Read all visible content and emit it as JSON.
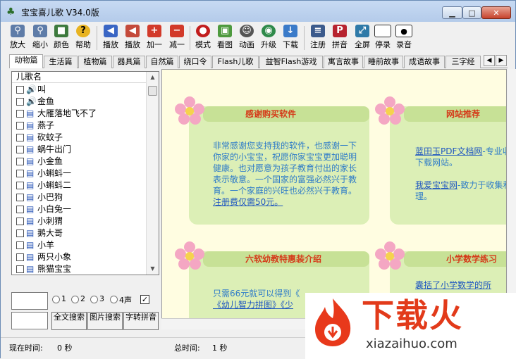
{
  "window": {
    "title": "宝宝喜儿歌 V34.0版"
  },
  "toolbar": {
    "items": [
      {
        "label": "放大",
        "icon": "zoom-in-icon"
      },
      {
        "label": "缩小",
        "icon": "zoom-out-icon"
      },
      {
        "label": "颜色",
        "icon": "color-icon"
      },
      {
        "label": "帮助",
        "icon": "help-icon"
      },
      {
        "label": "播放",
        "icon": "play-icon"
      },
      {
        "label": "播放",
        "icon": "play-all-icon"
      },
      {
        "label": "加一",
        "icon": "plus-icon"
      },
      {
        "label": "减一",
        "icon": "minus-icon"
      },
      {
        "label": "模式",
        "icon": "mode-icon"
      },
      {
        "label": "看图",
        "icon": "picture-icon"
      },
      {
        "label": "动画",
        "icon": "animation-icon"
      },
      {
        "label": "升级",
        "icon": "upgrade-icon"
      },
      {
        "label": "下载",
        "icon": "download-icon"
      },
      {
        "label": "注册",
        "icon": "register-icon"
      },
      {
        "label": "拼音",
        "icon": "pinyin-icon"
      },
      {
        "label": "全屏",
        "icon": "fullscreen-icon"
      },
      {
        "label": "停录",
        "icon": "stop-record-icon"
      },
      {
        "label": "录音",
        "icon": "record-icon"
      }
    ]
  },
  "tabs": [
    "动物篇",
    "生活篇",
    "植物篇",
    "器具篇",
    "自然篇",
    "绕口令",
    "Flash儿歌",
    "益智Flash游戏",
    "寓言故事",
    "睡前故事",
    "成语故事",
    "三字经"
  ],
  "list": {
    "header": "儿歌名",
    "items": [
      {
        "label": "叫",
        "type": "audio"
      },
      {
        "label": "金鱼",
        "type": "audio"
      },
      {
        "label": "大雁落地飞不了",
        "type": "text"
      },
      {
        "label": "燕子",
        "type": "text"
      },
      {
        "label": "砍蚊子",
        "type": "text"
      },
      {
        "label": "蜗牛出门",
        "type": "text"
      },
      {
        "label": "小金鱼",
        "type": "text"
      },
      {
        "label": "小蝌蚪一",
        "type": "text"
      },
      {
        "label": "小蝌蚪二",
        "type": "text"
      },
      {
        "label": "小巴狗",
        "type": "text"
      },
      {
        "label": "小白兔一",
        "type": "text"
      },
      {
        "label": "小刺猬",
        "type": "text"
      },
      {
        "label": "鹅大哥",
        "type": "text"
      },
      {
        "label": "小羊",
        "type": "text"
      },
      {
        "label": "两只小象",
        "type": "text"
      },
      {
        "label": "熊猫宝宝",
        "type": "text"
      }
    ]
  },
  "filter": {
    "tones": [
      "1",
      "2",
      "3",
      "4声"
    ],
    "check": "✓",
    "buttons": [
      "全文搜索",
      "图片搜索",
      "字转拼音"
    ]
  },
  "cards": [
    {
      "title": "感谢购买软件",
      "body": "非常感谢您支持我的软件，也感谢一下你家的小宝宝，祝愿你家宝宝更加聪明健康。也对愿意为孩子教育付出的家长表示敬意。一个国家的富强必然兴于教育。一个家庭的兴旺也必然兴于教育。",
      "link": "注册费仅需50元。"
    },
    {
      "title": "网站推荐",
      "link1": "蓝田玉PDF文档网",
      "body1": "-专业收集和下载网站。",
      "link2": "我爱宝宝网",
      "body2": "-致力于收集和整理。"
    },
    {
      "title": "六软幼教特惠装介绍",
      "body": "只需66元就可以得到《",
      "link": "《幼儿智力拼图》《少"
    },
    {
      "title": "小学数学练习",
      "link": "囊括了小学数学的所"
    }
  ],
  "status": {
    "current_label": "现在时间:",
    "current_value": "0 秒",
    "total_label": "总时间:",
    "total_value": "1 秒"
  },
  "watermark": {
    "text": "下载火",
    "sub": "xiazaihuo.com"
  }
}
